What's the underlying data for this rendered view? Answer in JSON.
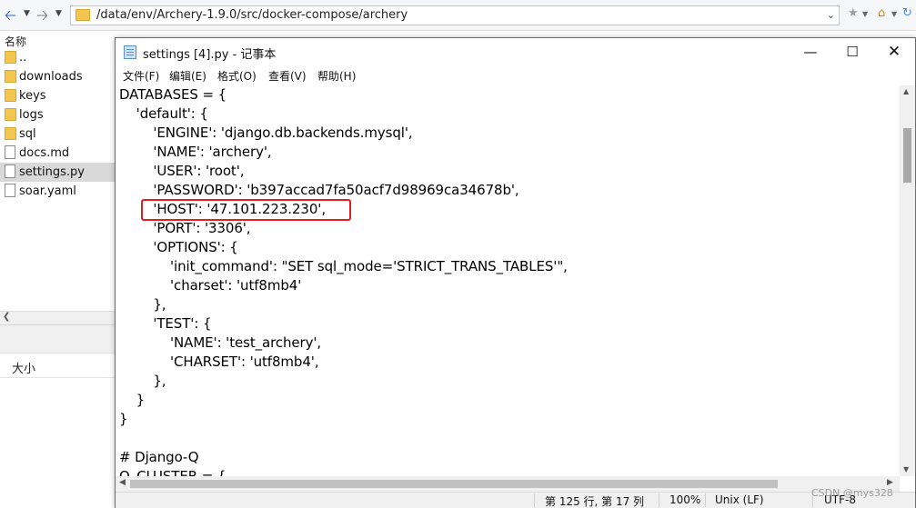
{
  "explorer": {
    "address_path": "/data/env/Archery-1.9.0/src/docker-compose/archery",
    "column_name": "名称",
    "size_label": "大小",
    "items": [
      {
        "label": "..",
        "type": "folder"
      },
      {
        "label": "downloads",
        "type": "folder"
      },
      {
        "label": "keys",
        "type": "folder"
      },
      {
        "label": "logs",
        "type": "folder"
      },
      {
        "label": "sql",
        "type": "folder"
      },
      {
        "label": "docs.md",
        "type": "file"
      },
      {
        "label": "settings.py",
        "type": "file",
        "selected": true
      },
      {
        "label": "soar.yaml",
        "type": "file"
      }
    ],
    "icons": {
      "back": "back-arrow-icon",
      "forward": "forward-arrow-icon",
      "star": "star-icon",
      "home": "home-icon",
      "refresh": "refresh-icon"
    }
  },
  "notepad": {
    "title": "settings [4].py - 记事本",
    "menu": [
      "文件(F)",
      "编辑(E)",
      "格式(O)",
      "查看(V)",
      "帮助(H)"
    ],
    "code_lines": [
      "DATABASES = {",
      "    'default': {",
      "        'ENGINE': 'django.db.backends.mysql',",
      "        'NAME': 'archery',",
      "        'USER': 'root',",
      "        'PASSWORD': 'b397accad7fa50acf7d98969ca34678b',",
      "        'HOST': '47.101.223.230',",
      "        'PORT': '3306',",
      "        'OPTIONS': {",
      "            'init_command': \"SET sql_mode='STRICT_TRANS_TABLES'\",",
      "            'charset': 'utf8mb4'",
      "        },",
      "        'TEST': {",
      "            'NAME': 'test_archery',",
      "            'CHARSET': 'utf8mb4',",
      "        },",
      "    }",
      "}",
      "",
      "# Django-Q",
      "Q_CLUSTER = {"
    ],
    "status": {
      "position": "第 125 行, 第 17 列",
      "zoom": "100%",
      "line_ending": "Unix (LF)",
      "encoding": "UTF-8"
    },
    "highlight_color": "#e0201f"
  },
  "watermark": "CSDN @mys328"
}
